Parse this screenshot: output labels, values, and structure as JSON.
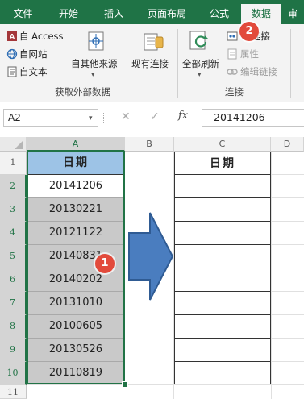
{
  "ribbon": {
    "tabs": [
      {
        "label": "文件"
      },
      {
        "label": "开始"
      },
      {
        "label": "插入"
      },
      {
        "label": "页面布局"
      },
      {
        "label": "公式"
      },
      {
        "label": "数据"
      },
      {
        "label": "审"
      }
    ],
    "external_data": {
      "access": "Access",
      "web": "自网站",
      "text": "自文本",
      "other_sources": "自其他来源",
      "existing": "现有连接",
      "group_label": "获取外部数据"
    },
    "connections": {
      "refresh_all": "全部刷新",
      "connections": "连接",
      "properties": "属性",
      "edit_links": "编辑链接",
      "group_label": "连接"
    }
  },
  "formula_bar": {
    "name_box": "A2",
    "fx": "fx",
    "cancel": "✕",
    "enter": "✓",
    "formula": "20141206"
  },
  "grid": {
    "columns": [
      "A",
      "B",
      "C",
      "D"
    ],
    "rows": [
      "1",
      "2",
      "3",
      "4",
      "5",
      "6",
      "7",
      "8",
      "9",
      "10",
      "11"
    ],
    "header_A": "日期",
    "header_C": "日期",
    "values_A": [
      "20141206",
      "20130221",
      "20121122",
      "20140831",
      "20140202",
      "20131010",
      "20100605",
      "20130526",
      "20110819"
    ]
  },
  "badges": {
    "one": "1",
    "two": "2"
  },
  "colors": {
    "excel_green": "#1f7346",
    "header_blue": "#9dc3e6",
    "arrow_blue": "#4a7dbf",
    "badge_red": "#e24a3b"
  }
}
